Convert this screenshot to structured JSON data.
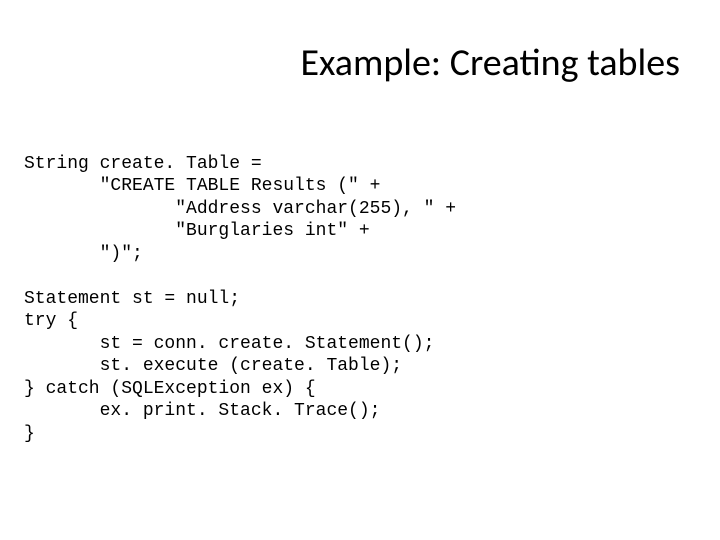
{
  "title": "Example: Creating tables",
  "code": {
    "l01": "String create. Table =",
    "l02": "       \"CREATE TABLE Results (\" +",
    "l03": "              \"Address varchar(255), \" +",
    "l04": "              \"Burglaries int\" +",
    "l05": "       \")\";",
    "l06": "",
    "l07": "Statement st = null;",
    "l08": "try {",
    "l09": "       st = conn. create. Statement();",
    "l10": "       st. execute (create. Table);",
    "l11": "} catch (SQLException ex) {",
    "l12": "       ex. print. Stack. Trace();",
    "l13": "}"
  }
}
